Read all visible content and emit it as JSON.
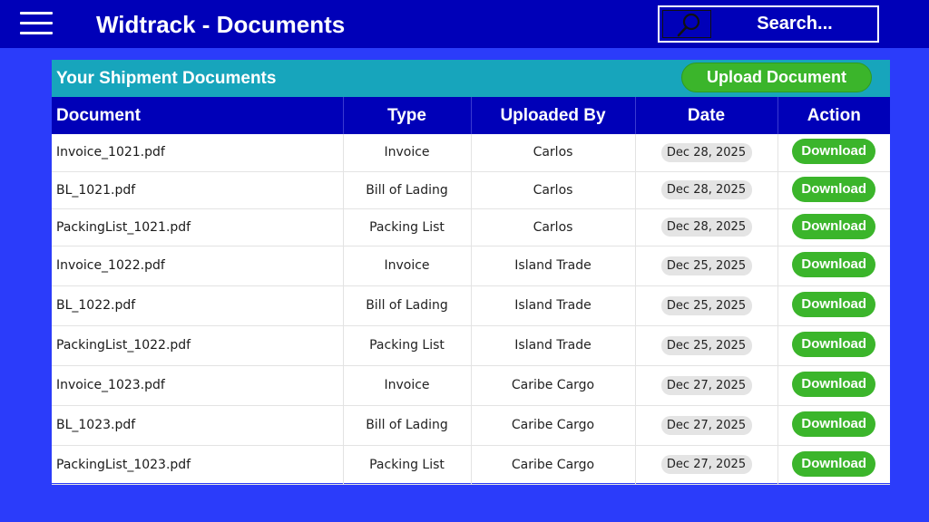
{
  "header": {
    "title": "Widtrack - Documents",
    "search_label": "Search...",
    "background": "#0000b8"
  },
  "panel": {
    "title": "Your Shipment Documents",
    "upload_label": "Upload Document",
    "header_color": "#17a5bc",
    "accent_green": "#3bb52b"
  },
  "table": {
    "columns": [
      "Document",
      "Type",
      "Uploaded By",
      "Date",
      "Action"
    ],
    "rows": [
      {
        "document": "Invoice_1021.pdf",
        "type": "Invoice",
        "uploaded_by": "Carlos",
        "date": "Dec 28, 2025",
        "action": "Download"
      },
      {
        "document": "BL_1021.pdf",
        "type": "Bill of Lading",
        "uploaded_by": "Carlos",
        "date": "Dec 28, 2025",
        "action": "Download"
      },
      {
        "document": "PackingList_1021.pdf",
        "type": "Packing List",
        "uploaded_by": "Carlos",
        "date": "Dec 28, 2025",
        "action": "Download"
      },
      {
        "document": "Invoice_1022.pdf",
        "type": "Invoice",
        "uploaded_by": "Island Trade",
        "date": "Dec 25, 2025",
        "action": "Download"
      },
      {
        "document": "BL_1022.pdf",
        "type": "Bill of Lading",
        "uploaded_by": "Island Trade",
        "date": "Dec 25, 2025",
        "action": "Download"
      },
      {
        "document": "PackingList_1022.pdf",
        "type": "Packing List",
        "uploaded_by": "Island Trade",
        "date": "Dec 25, 2025",
        "action": "Download"
      },
      {
        "document": "Invoice_1023.pdf",
        "type": "Invoice",
        "uploaded_by": "Caribe Cargo",
        "date": "Dec 27, 2025",
        "action": "Download"
      },
      {
        "document": "BL_1023.pdf",
        "type": "Bill of Lading",
        "uploaded_by": "Caribe Cargo",
        "date": "Dec 27, 2025",
        "action": "Download"
      },
      {
        "document": "PackingList_1023.pdf",
        "type": "Packing List",
        "uploaded_by": "Caribe Cargo",
        "date": "Dec 27, 2025",
        "action": "Download"
      }
    ]
  },
  "icons": {
    "menu": "hamburger-menu-icon",
    "search": "search-icon"
  }
}
